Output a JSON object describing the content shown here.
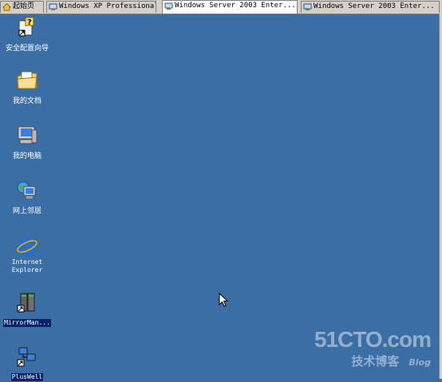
{
  "tabs": [
    {
      "label": "起始页",
      "active": false
    },
    {
      "label": "Windows XP Professional",
      "active": false
    },
    {
      "label": "Windows Server 2003 Enter...",
      "active": true
    },
    {
      "label": "Windows Server 2003 Enter...",
      "active": false
    }
  ],
  "desktop": {
    "background_color": "#3a6ea5",
    "icons": [
      {
        "label": "安全配置向导",
        "icon": "security-wizard-icon"
      },
      {
        "label": "我的文档",
        "icon": "my-documents-icon"
      },
      {
        "label": "我的电脑",
        "icon": "my-computer-icon"
      },
      {
        "label": "网上邻居",
        "icon": "network-places-icon"
      },
      {
        "label": "Internet Explorer",
        "icon": "internet-explorer-icon"
      },
      {
        "label": "MirrorMan...",
        "icon": "mirrorman-server-icon",
        "selected": true
      },
      {
        "label": "PlusWell",
        "icon": "pluswell-network-icon"
      }
    ]
  },
  "watermark": {
    "logo": "51CTO.com",
    "subtitle": "技术博客",
    "blog": "Blog"
  }
}
